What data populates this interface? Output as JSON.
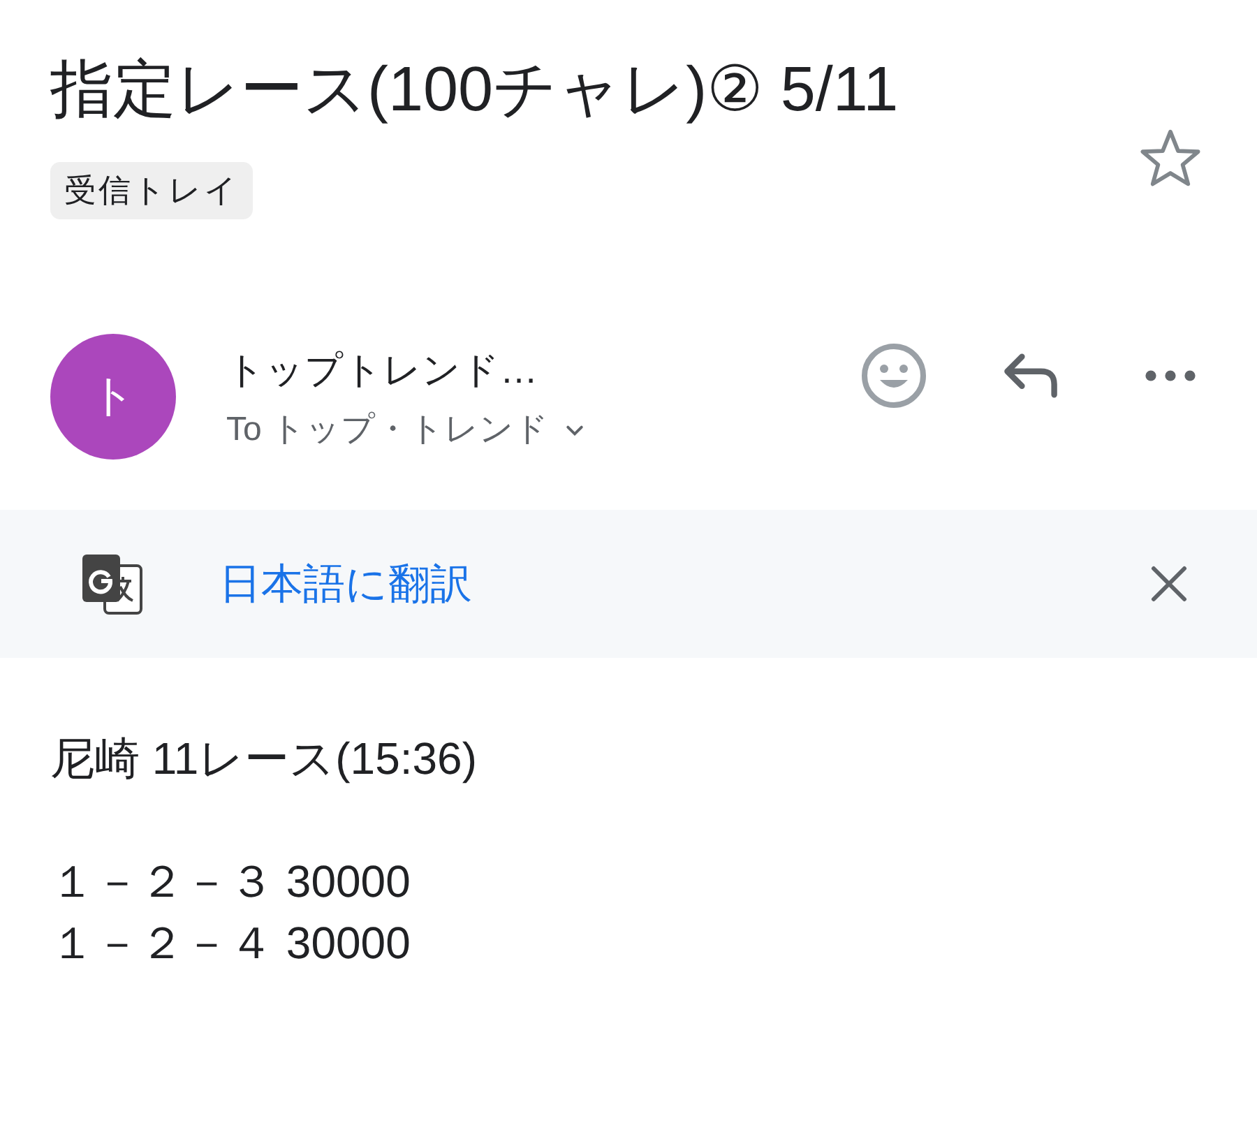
{
  "header": {
    "subject": "指定レース(100チャレ)② 5/11",
    "label": "受信トレイ",
    "starred": false
  },
  "message": {
    "avatar_initial": "ト",
    "sender_name": "トップトレンド…",
    "recipients": "To トップ・トレンド",
    "recipients_expanded": false
  },
  "translate_banner": {
    "link": "日本語に翻訳"
  },
  "body": {
    "paragraphs": [
      [
        "尼崎 11レース(15:36)"
      ],
      [
        "１－２－３ 30000",
        "１－２－４ 30000"
      ]
    ]
  }
}
